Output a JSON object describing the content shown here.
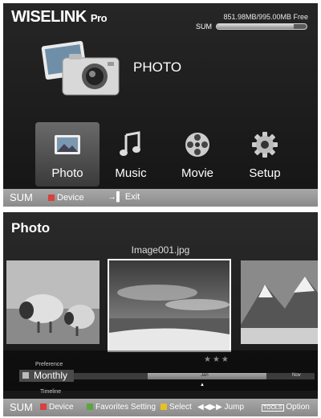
{
  "wiselink": {
    "brand": "WISELINK",
    "brand_suffix": "Pro",
    "free_space": "851.98MB/995.00MB Free",
    "sum_label": "SUM",
    "storage_used_fraction": 0.856,
    "selected_title": "PHOTO",
    "menu": [
      {
        "label": "Photo",
        "icon": "photo-icon",
        "selected": true
      },
      {
        "label": "Music",
        "icon": "music-note-icon",
        "selected": false
      },
      {
        "label": "Movie",
        "icon": "film-reel-icon",
        "selected": false
      },
      {
        "label": "Setup",
        "icon": "gear-icon",
        "selected": false
      }
    ],
    "status": {
      "sum": "SUM",
      "device": "Device",
      "exit": "Exit"
    }
  },
  "photo": {
    "title": "Photo",
    "filename": "Image001.jpg",
    "rating_stars": "★★★",
    "preference": "Preference",
    "timeline": "Timeline",
    "sort_mode": "Monthly",
    "months": [
      "Jan",
      "Nov"
    ],
    "status": {
      "sum": "SUM",
      "device": "Device",
      "favorites": "Favorites Setting",
      "select": "Select",
      "jump": "Jump",
      "tools": "TOOLS",
      "option": "Option"
    }
  },
  "colors": {
    "screen_bg": "#1e1e1e",
    "status_bar": "#9a9a9a",
    "device_red": "#d94040",
    "favorites_green": "#5aa640",
    "select_yellow": "#e8c020"
  }
}
